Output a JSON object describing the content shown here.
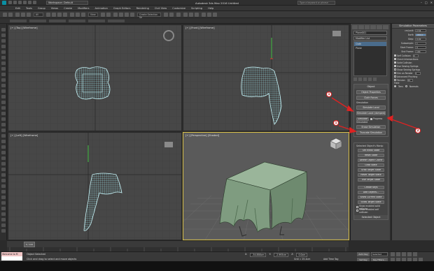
{
  "titlebar": {
    "workspace": "Workspace: Default",
    "title": "Autodesk 3ds Max 2016    Untitled",
    "search_placeholder": "Type a keyword or phrase",
    "window_buttons": [
      "–",
      "□",
      "✕"
    ]
  },
  "menubar": {
    "items": [
      "Edit",
      "Tools",
      "Group",
      "Views",
      "Create",
      "Modifiers",
      "Animation",
      "Graph Editors",
      "Rendering",
      "Civil View",
      "Customize",
      "Scripting",
      "Help"
    ]
  },
  "toolbar": {
    "selection_filter": "All",
    "view_dropdown": "View",
    "named_selection": "Create Selection Se"
  },
  "viewports": {
    "top": "[+] [Top] [Wireframe]",
    "front": "[+] [Front] [Wireframe]",
    "left": "[+] [Left] [Wireframe]",
    "perspective": "[+] [Perspective] [Shaded]"
  },
  "command_panel": {
    "object_name": "Plane001",
    "modifier_list": "Modifier List",
    "stack": [
      "Cloth",
      "Plane"
    ],
    "object_rollout": {
      "title": "Object",
      "object_properties": "Object Properties",
      "cloth_forces": "Cloth Forces",
      "simulation_label": "Simulation",
      "simulate_local": "Simulate Local",
      "simulate_local_damped": "Simulate Local (damped)",
      "simulate": "Simulate",
      "progress": "Progress",
      "simulated_label": "Simulated",
      "erase_simulation": "Erase Simulation",
      "truncate_simulation": "Truncate Simulation"
    },
    "selected_rollout": {
      "title": "Selected Object's Manip",
      "set_initial_state": "Set Initial State",
      "reset_state": "Reset State",
      "delete_object_cache": "Delete Object Cache",
      "grab_state": "Grab State",
      "grab_target_state": "Grab Target State",
      "reset_target_state": "Reset Target State",
      "use_target_state": "Use Target State",
      "create_keys": "Create Keys",
      "add_objects": "Add Objects...",
      "show_current_state": "Show Current State",
      "show_target_state": "Show Target State",
      "show_enabled_solid": "Show enabled solid collision",
      "show_enabled_self": "Show enabled self collision",
      "selected_object": "Selected Object"
    }
  },
  "simulation_params": {
    "title": "Simulation Parameters",
    "rows": [
      {
        "label": "cm/unit:",
        "value": "2.54"
      },
      {
        "label": "Earth",
        "value": "-980.0"
      },
      {
        "label": "Step:",
        "value": "0.02"
      },
      {
        "label": "Subsample:",
        "value": "1"
      },
      {
        "label": "Start Frame:",
        "value": "0"
      },
      {
        "label": "End Frame:",
        "value": "100"
      }
    ],
    "checks": [
      {
        "label": "Self Collision",
        "value": "0"
      },
      {
        "label": "Check Intersections",
        "on": true
      },
      {
        "label": "Solid Collision",
        "on": true
      },
      {
        "label": "Use Sewing Springs",
        "on": true
      },
      {
        "label": "Show Sewing Springs",
        "on": false
      },
      {
        "label": "Sim on Render",
        "value": "1"
      },
      {
        "label": "Advanced Pinching",
        "on": false
      },
      {
        "label": "Tension",
        "value": "10"
      }
    ],
    "field_label": "Field",
    "radios": [
      "Tens",
      "Normals"
    ]
  },
  "badges": [
    "1",
    "2",
    "1",
    "2"
  ],
  "timeslider": {
    "position": "0 / 100"
  },
  "status": {
    "maxscript_line1": "Welcome to M",
    "maxscript_line2": "",
    "selected": "Object Selected",
    "prompt": "Click and drag to select and move objects",
    "x_label": "X:",
    "x": "-34.858cm",
    "y_label": "Y:",
    "y": "-2.993cm",
    "z_label": "Z:",
    "z": "0.0cm",
    "grid": "Grid = 25.4cm",
    "add_time_tag": "Add Time Tag",
    "auto_key": "Auto Key",
    "selected_dropdown": "Selected",
    "set_key": "Set Key",
    "key_filters": "Key Filters..."
  },
  "colors": {
    "cloth": "#9ce7ee",
    "cloth_shaded": "#9ab59a",
    "active_border": "#d8c04a",
    "badge_ring": "#d22"
  }
}
